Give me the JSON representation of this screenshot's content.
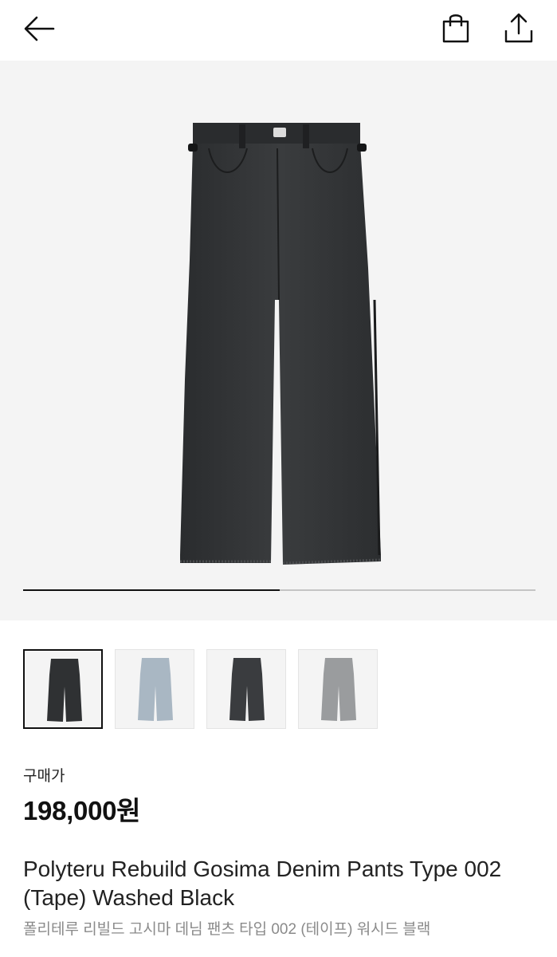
{
  "header": {
    "back_icon": "arrow-left-icon",
    "bag_icon": "shopping-bag-icon",
    "share_icon": "share-icon"
  },
  "gallery": {
    "current_image": 1,
    "total_images": 2,
    "progress": 0.5
  },
  "thumbnails": [
    {
      "name": "washed-black",
      "color": "#2f3133",
      "selected": true
    },
    {
      "name": "light-blue",
      "color": "#a9b7c3",
      "selected": false
    },
    {
      "name": "dark-charcoal",
      "color": "#3a3c3f",
      "selected": false
    },
    {
      "name": "grey",
      "color": "#9a9c9e",
      "selected": false
    }
  ],
  "product": {
    "price_label": "구매가",
    "price": "198,000원",
    "title_en": "Polyteru Rebuild Gosima Denim Pants Type 002 (Tape) Washed Black",
    "title_ko": "폴리테루 리빌드 고시마 데님 팬츠 타입 002 (테이프) 워시드 블랙"
  },
  "colors": {
    "hero_bg": "#f4f4f4",
    "denim": "#2f3133",
    "accent": "#111111"
  }
}
